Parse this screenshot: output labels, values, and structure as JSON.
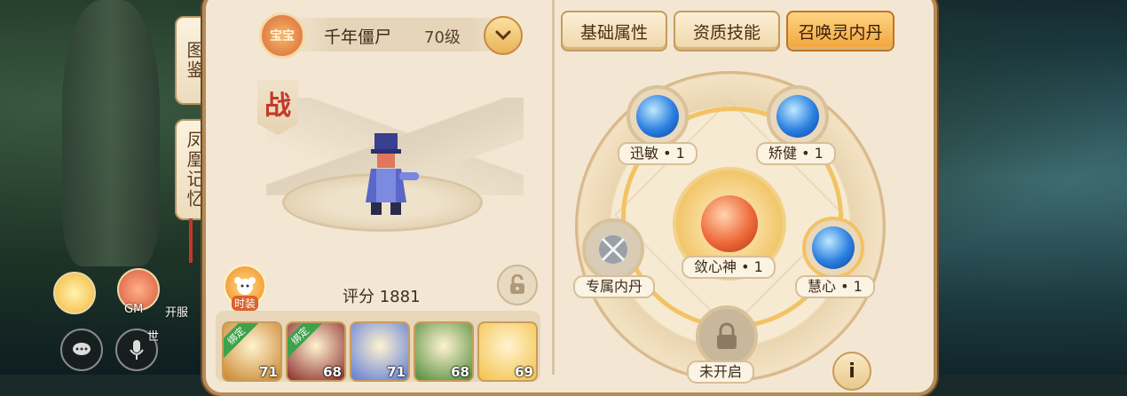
{
  "side_tabs": [
    {
      "label": "图鉴"
    },
    {
      "label": "凤凰记忆"
    }
  ],
  "pet": {
    "badge": "宝宝",
    "name": "千年僵尸",
    "level": "70级",
    "type_tag": "战",
    "costume_label": "时装",
    "score": "评分 1881"
  },
  "roster": [
    {
      "level": "71",
      "tag": "绑定",
      "color": "#c9842c"
    },
    {
      "level": "68",
      "tag": "绑定",
      "color": "#8a2c2c"
    },
    {
      "level": "71",
      "tag": "",
      "color": "#5c7ad8"
    },
    {
      "level": "68",
      "tag": "",
      "color": "#4f8a3a"
    },
    {
      "level": "69",
      "tag": "",
      "color": "#f3c24a"
    }
  ],
  "tabs": [
    {
      "label": "基础属性",
      "active": false
    },
    {
      "label": "资质技能",
      "active": false
    },
    {
      "label": "召唤灵内丹",
      "active": true
    }
  ],
  "neidan": {
    "top_left": "迅敏 • 1",
    "top_right": "矫健 • 1",
    "center": "敛心神 • 1",
    "left": "专属内丹",
    "right": "慧心 • 1",
    "bottom": "未开启"
  },
  "hud": {
    "gm_label": "GM",
    "open_label": "开服",
    "world_label": "世"
  },
  "colors": {
    "accent": "#f2a43c",
    "panel": "#f3e7d3",
    "border": "#b58a55"
  }
}
